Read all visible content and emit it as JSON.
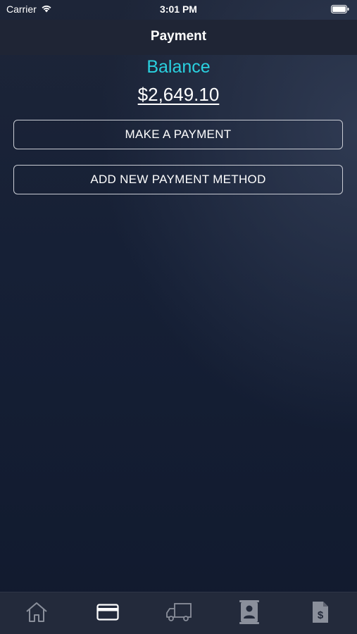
{
  "status_bar": {
    "carrier": "Carrier",
    "time": "3:01 PM",
    "wifi_icon": "wifi-icon",
    "battery_icon": "battery-icon"
  },
  "header": {
    "title": "Payment"
  },
  "balance": {
    "label": "Balance",
    "amount": "$2,649.10"
  },
  "actions": {
    "make_payment_label": "MAKE A PAYMENT",
    "add_method_label": "ADD NEW PAYMENT METHOD"
  },
  "tab_bar": {
    "tabs": [
      {
        "icon": "home-icon",
        "selected": false
      },
      {
        "icon": "credit-card-icon",
        "selected": true
      },
      {
        "icon": "truck-icon",
        "selected": false
      },
      {
        "icon": "contact-book-icon",
        "selected": false
      },
      {
        "icon": "invoice-dollar-icon",
        "selected": false
      }
    ]
  },
  "colors": {
    "accent": "#2ad1e0",
    "background": "#162036",
    "nav_bar": "#1f2535",
    "tab_bar": "#232a3b",
    "tab_icon_inactive": "#8a8f9b",
    "tab_icon_active": "#ffffff"
  }
}
